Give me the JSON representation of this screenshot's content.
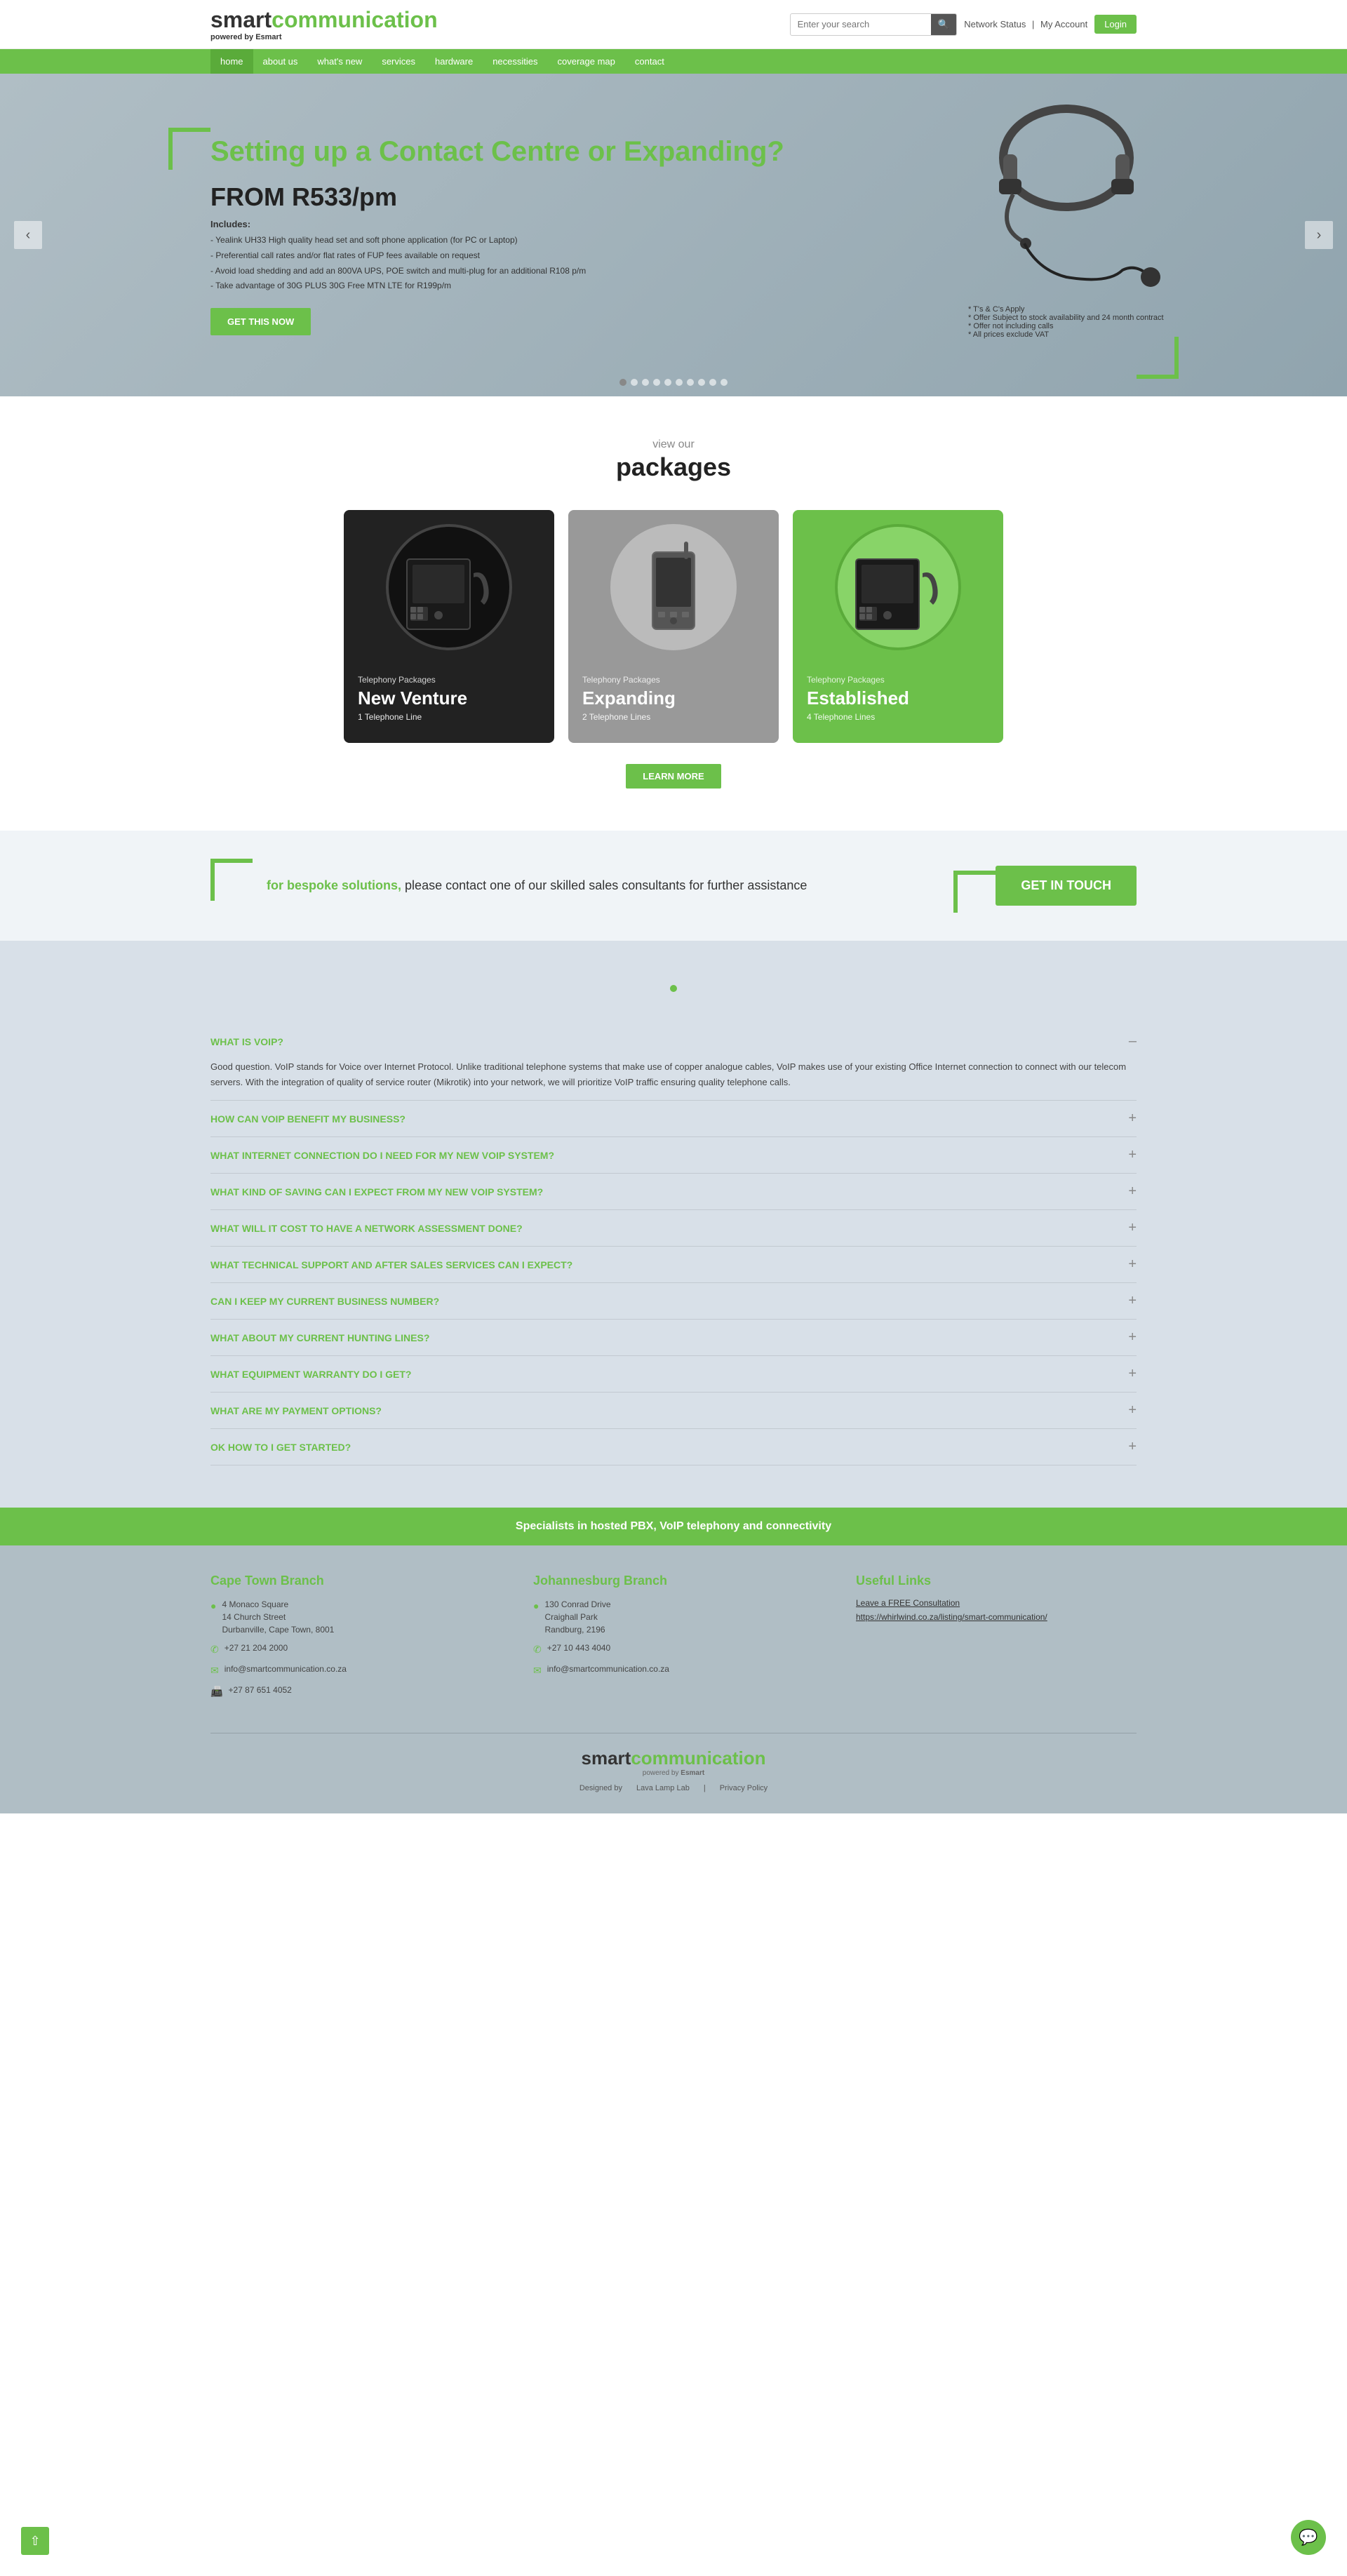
{
  "header": {
    "logo": {
      "smart": "smart",
      "communication": "communication",
      "powered_by": "powered by",
      "brand": "Esmart"
    },
    "search": {
      "placeholder": "Enter your search"
    },
    "network_status": "Network Status",
    "my_account": "My Account",
    "login_label": "Login"
  },
  "nav": {
    "items": [
      {
        "label": "home",
        "active": true
      },
      {
        "label": "about us",
        "active": false
      },
      {
        "label": "what's new",
        "active": false
      },
      {
        "label": "services",
        "active": false
      },
      {
        "label": "hardware",
        "active": false
      },
      {
        "label": "necessities",
        "active": false
      },
      {
        "label": "coverage map",
        "active": false
      },
      {
        "label": "contact",
        "active": false
      }
    ]
  },
  "hero": {
    "title": "Setting up a Contact Centre or Expanding?",
    "price_label": "FROM R533/pm",
    "includes_label": "Includes:",
    "bullet_points": [
      "- Yealink UH33 High quality head set and soft phone application (for PC or Laptop)",
      "- Preferential call rates and/or flat rates of FUP fees available on request",
      "- Avoid load shedding and add an 800VA UPS, POE switch and multi-plug for an additional R108 p/m",
      "- Take advantage of 30G PLUS 30G Free MTN LTE for R199p/m"
    ],
    "cta_label": "GET THIS NOW",
    "notes": [
      "* T's & C's Apply",
      "* Offer Subject to stock availability and 24 month contract",
      "* Offer not including calls",
      "* All prices exclude VAT"
    ],
    "dots": 10,
    "prev_arrow": "‹",
    "next_arrow": "›"
  },
  "packages": {
    "view_label": "view our",
    "title": "packages",
    "items": [
      {
        "type": "Telephony Packages",
        "name": "New Venture",
        "lines": "1 Telephone Line",
        "theme": "dark"
      },
      {
        "type": "Telephony Packages",
        "name": "Expanding",
        "lines": "2 Telephone Lines",
        "theme": "gray"
      },
      {
        "type": "Telephony Packages",
        "name": "Established",
        "lines": "4 Telephone Lines",
        "theme": "green"
      }
    ],
    "learn_more_label": "LEARN MORE"
  },
  "bespoke": {
    "text_prefix": "for bespoke solutions,",
    "text_suffix": " please contact one of our skilled sales consultants for further assistance",
    "cta_label": "GET IN TOUCH"
  },
  "faq": {
    "items": [
      {
        "question": "WHAT IS VOIP?",
        "answer": "Good question. VoIP stands for Voice over Internet Protocol. Unlike traditional telephone systems that make use of copper analogue cables, VoIP makes use of your existing Office Internet connection to connect with our telecom servers. With the integration of quality of service router (Mikrotik) into your network, we will prioritize VoIP traffic ensuring quality telephone calls.",
        "open": true
      },
      {
        "question": "HOW CAN VOIP BENEFIT MY BUSINESS?",
        "answer": "",
        "open": false
      },
      {
        "question": "WHAT INTERNET CONNECTION DO I NEED FOR MY NEW VOIP SYSTEM?",
        "answer": "",
        "open": false
      },
      {
        "question": "WHAT KIND OF SAVING CAN I EXPECT FROM MY NEW VOIP SYSTEM?",
        "answer": "",
        "open": false
      },
      {
        "question": "WHAT WILL IT COST TO HAVE A NETWORK ASSESSMENT DONE?",
        "answer": "",
        "open": false
      },
      {
        "question": "WHAT TECHNICAL SUPPORT AND AFTER SALES SERVICES CAN I EXPECT?",
        "answer": "",
        "open": false
      },
      {
        "question": "CAN I KEEP MY CURRENT BUSINESS NUMBER?",
        "answer": "",
        "open": false
      },
      {
        "question": "WHAT ABOUT MY CURRENT HUNTING LINES?",
        "answer": "",
        "open": false
      },
      {
        "question": "WHAT EQUIPMENT WARRANTY DO I GET?",
        "answer": "",
        "open": false
      },
      {
        "question": "WHAT ARE MY PAYMENT OPTIONS?",
        "answer": "",
        "open": false
      },
      {
        "question": "OK HOW TO I GET STARTED?",
        "answer": "",
        "open": false
      }
    ]
  },
  "footer_banner": {
    "text": "Specialists in hosted PBX, VoIP telephony and connectivity"
  },
  "footer": {
    "cape_town": {
      "title_plain": "Cape Town",
      "title_highlight": "Branch",
      "address1": "4 Monaco Square",
      "address2": "14 Church Street",
      "address3": "Durbanville, Cape Town, 8001",
      "phone": "+27 21 204 2000",
      "email": "info@smartcommunication.co.za",
      "fax": "+27 87 651 4052"
    },
    "johannesburg": {
      "title_plain": "Johannesburg",
      "title_highlight": "Branch",
      "address1": "130 Conrad Drive",
      "address2": "Craighall Park",
      "address3": "Randburg, 2196",
      "phone": "+27 10 443 4040",
      "email": "info@smartcommunication.co.za"
    },
    "useful_links": {
      "title_plain": "Useful",
      "title_highlight": "Links",
      "link1_label": "Leave a FREE Consultation",
      "link2_label": "https://whirlwind.co.za/listing/smart-communication/"
    },
    "designed_by": "Designed by",
    "designed_by_link": "Lava Lamp Lab",
    "privacy_policy": "Privacy Policy"
  }
}
